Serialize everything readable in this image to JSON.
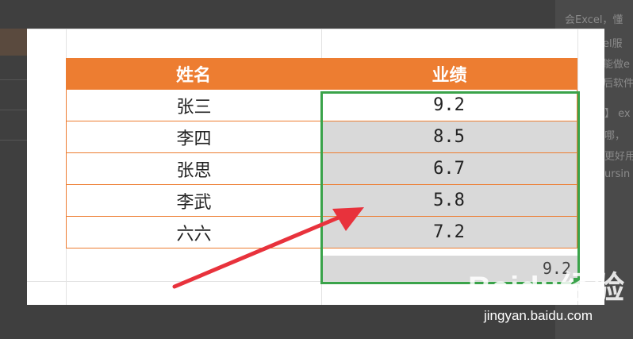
{
  "background": {
    "lines": [
      "会Excel，懂",
      "el服",
      "能做e",
      "后软件",
      "】 ex",
      "哪，",
      "更好用",
      "ursin"
    ]
  },
  "table": {
    "headers": [
      "姓名",
      "业绩"
    ],
    "rows": [
      {
        "name": "张三",
        "score": "9.2"
      },
      {
        "name": "李四",
        "score": "8.5"
      },
      {
        "name": "张思",
        "score": "6.7"
      },
      {
        "name": "李武",
        "score": "5.8"
      },
      {
        "name": "六六",
        "score": "7.2"
      }
    ],
    "result": "9.2"
  },
  "watermark": {
    "brand": "Baidu经验",
    "url": "jingyan.baidu.com"
  },
  "colors": {
    "header": "#ed7d31",
    "selection": "#3aa34a",
    "arrow": "#e8323c"
  }
}
